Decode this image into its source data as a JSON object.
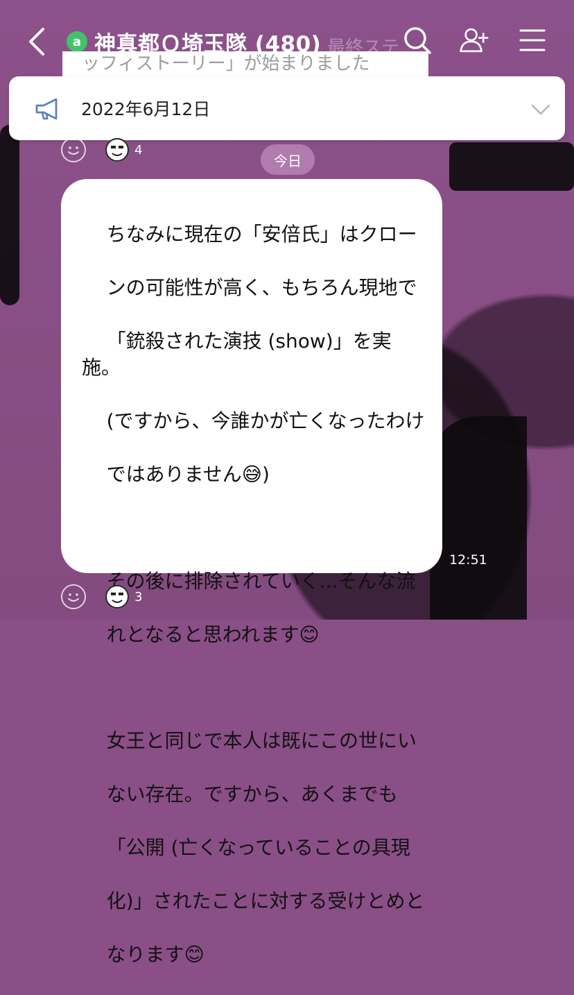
{
  "header": {
    "badge_letter": "a",
    "title": "神真都Ｑ埼玉隊 (480)"
  },
  "background_notice": {
    "line1": "最終ステ",
    "line2": "ッフィストーリー」が始まりました"
  },
  "announcement": {
    "date": "2022年6月12日"
  },
  "top_reactions": {
    "count": "4"
  },
  "date_divider": "今日",
  "message": {
    "para1_lines": [
      "ちなみに現在の「安倍氏」はクロー",
      "ンの可能性が高く、もちろん現地で",
      "「銃殺された演技 (show)」を実施。",
      "(ですから、今誰かが亡くなったわけ",
      "ではありません😅)"
    ],
    "para2_lines": [
      "その後に排除されていく...そんな流",
      "れとなると思われます😊"
    ],
    "para3_lines": [
      "女王と同じで本人は既にこの世にい",
      "ない存在。ですから、あくまでも",
      "「公開 (亡くなっていることの具現",
      "化)」されたことに対する受けとめと",
      "なります😊"
    ],
    "time": "12:51"
  },
  "bottom_reactions": {
    "count": "3"
  },
  "colors": {
    "background": "#8a4f86",
    "badge": "#43c26a"
  }
}
